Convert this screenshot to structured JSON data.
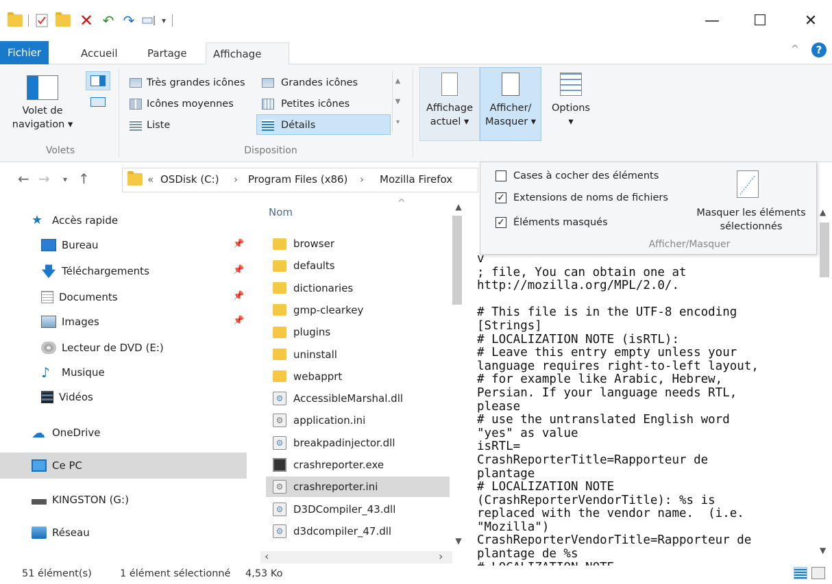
{
  "window": {
    "minimize": "—",
    "maximize": "☐",
    "close": "✕"
  },
  "ribbon_tabs": [
    "Fichier",
    "Accueil",
    "Partage",
    "Affichage"
  ],
  "ribbon": {
    "volet_line1": "Volet de",
    "volet_line2": "navigation ▾",
    "group_volets": "Volets",
    "layout_options": {
      "tres_grandes": "Très grandes icônes",
      "grandes": "Grandes icônes",
      "moyennes": "Icônes moyennes",
      "petites": "Petites icônes",
      "liste": "Liste",
      "details": "Détails"
    },
    "group_disposition": "Disposition",
    "affichage_line1": "Affichage",
    "affichage_line2": "actuel ▾",
    "afficher_line1": "Afficher/",
    "afficher_line2": "Masquer ▾",
    "options_line1": "Options",
    "options_line2": "▾"
  },
  "address": {
    "prefix": "«",
    "crumbs": [
      "OSDisk (C:)",
      "Program Files (x86)",
      "Mozilla Firefox"
    ],
    "separator": "›"
  },
  "popup": {
    "cb1": "Cases à cocher des éléments",
    "cb2": "Extensions de noms de fichiers",
    "cb3": "Éléments masqués",
    "cb1_checked": false,
    "cb2_checked": true,
    "cb3_checked": true,
    "hide_line1": "Masquer les éléments",
    "hide_line2": "sélectionnés",
    "group": "Afficher/Masquer"
  },
  "nav": [
    {
      "label": "Accès rapide"
    },
    {
      "label": "Bureau"
    },
    {
      "label": "Téléchargements"
    },
    {
      "label": "Documents"
    },
    {
      "label": "Images"
    },
    {
      "label": "Lecteur de DVD (E:)"
    },
    {
      "label": "Musique"
    },
    {
      "label": "Vidéos"
    },
    {
      "label": "OneDrive"
    },
    {
      "label": "Ce PC"
    },
    {
      "label": "KINGSTON (G:)"
    },
    {
      "label": "Réseau"
    }
  ],
  "filelist": {
    "header": "Nom",
    "files": [
      {
        "name": "browser",
        "type": "folder"
      },
      {
        "name": "defaults",
        "type": "folder"
      },
      {
        "name": "dictionaries",
        "type": "folder"
      },
      {
        "name": "gmp-clearkey",
        "type": "folder"
      },
      {
        "name": "plugins",
        "type": "folder"
      },
      {
        "name": "uninstall",
        "type": "folder"
      },
      {
        "name": "webapprt",
        "type": "folder"
      },
      {
        "name": "AccessibleMarshal.dll",
        "type": "dll"
      },
      {
        "name": "application.ini",
        "type": "ini"
      },
      {
        "name": "breakpadinjector.dll",
        "type": "dll"
      },
      {
        "name": "crashreporter.exe",
        "type": "exe"
      },
      {
        "name": "crashreporter.ini",
        "type": "ini",
        "selected": true
      },
      {
        "name": "D3DCompiler_43.dll",
        "type": "dll"
      },
      {
        "name": "d3dcompiler_47.dll",
        "type": "dll"
      }
    ]
  },
  "preview_text": "v\n; file, You can obtain one at\nhttp://mozilla.org/MPL/2.0/.\n\n# This file is in the UTF-8 encoding\n[Strings]\n# LOCALIZATION NOTE (isRTL):\n# Leave this entry empty unless your\nlanguage requires right-to-left layout,\n# for example like Arabic, Hebrew,\nPersian. If your language needs RTL,\nplease\n# use the untranslated English word\n\"yes\" as value\nisRTL=\nCrashReporterTitle=Rapporteur de\nplantage\n# LOCALIZATION NOTE\n(CrashReporterVendorTitle): %s is\nreplaced with the vendor name.  (i.e.\n\"Mozilla\")\nCrashReporterVendorTitle=Rapporteur de\nplantage de %s\n# LOCALIZATION NOTE",
  "status": {
    "count": "51 élément(s)",
    "selected": "1 élément sélectionné",
    "size": "4,53 Ko"
  },
  "colors": {
    "accent": "#1979ca",
    "selection": "#cce4f7",
    "folder": "#f5c842"
  }
}
